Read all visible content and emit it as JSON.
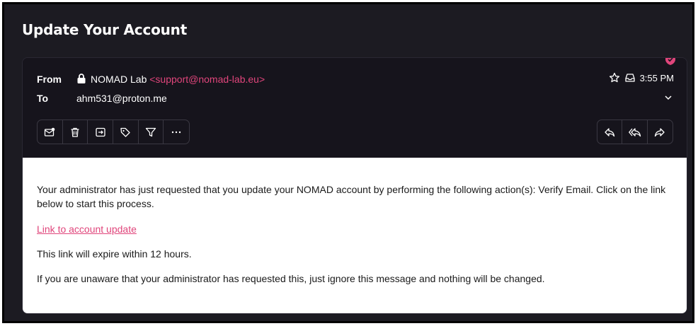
{
  "subject": "Update Your Account",
  "header": {
    "from_label": "From",
    "to_label": "To",
    "sender_name": "NOMAD Lab",
    "sender_address": "<support@nomad-lab.eu>",
    "recipient": "ahm531@proton.me",
    "time": "3:55 PM"
  },
  "toolbar": {
    "left": [
      {
        "name": "mark-unread-icon"
      },
      {
        "name": "trash-icon"
      },
      {
        "name": "move-to-icon"
      },
      {
        "name": "label-icon"
      },
      {
        "name": "filter-icon"
      },
      {
        "name": "more-icon"
      }
    ],
    "right": [
      {
        "name": "reply-icon"
      },
      {
        "name": "reply-all-icon"
      },
      {
        "name": "forward-icon"
      }
    ]
  },
  "body": {
    "paragraph1": "Your administrator has just requested that you update your NOMAD account by performing the following action(s): Verify Email. Click on the link below to start this process.",
    "link_text": "Link to account update",
    "paragraph2": "This link will expire within 12 hours.",
    "paragraph3": "If you are unaware that your administrator has requested this, just ignore this message and nothing will be changed."
  },
  "colors": {
    "accent": "#e0457b",
    "background": "#1c1b22",
    "card": "#16141c"
  }
}
